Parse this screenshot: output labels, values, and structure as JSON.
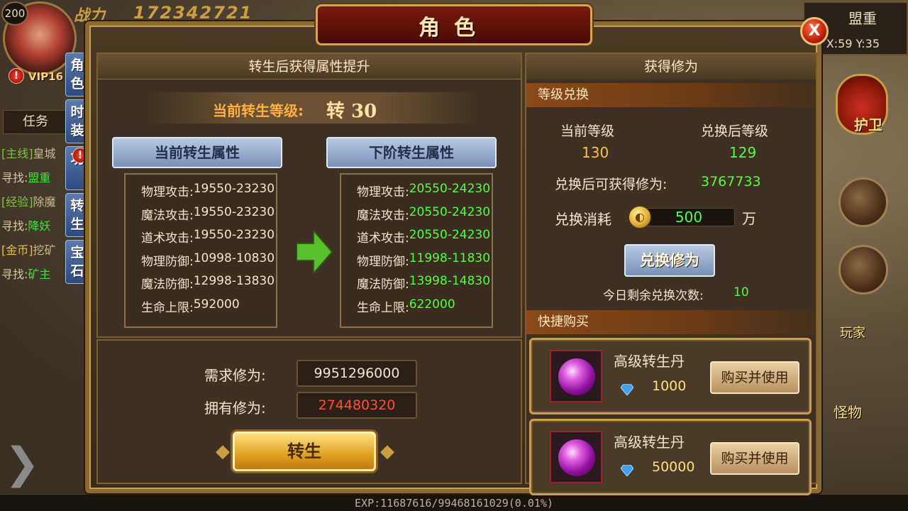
{
  "hud": {
    "player_level": "200",
    "vip": "VIP16",
    "combat_label": "战力",
    "combat_power": "172342721",
    "task_tab": "任务",
    "tasks": [
      {
        "tag": "[主线]",
        "text": "皇城"
      },
      {
        "find": "寻找:",
        "link": "盟重"
      },
      {
        "tag": "[经验]",
        "text": "除魔"
      },
      {
        "find": "寻找:",
        "link": "降妖"
      },
      {
        "tag": "[金币]",
        "text": "挖矿"
      },
      {
        "find": "寻找:",
        "link": "矿主"
      }
    ],
    "side_tabs": [
      "角色",
      "时装",
      "功",
      "转生",
      "宝石"
    ],
    "map_name": "盟重",
    "map_coords": "X:59 Y:35",
    "guard_label": "护卫",
    "player_label": "玩家",
    "monster_label": "怪物",
    "exp_text": "EXP:11687616/99468161029(0.01%)"
  },
  "panel": {
    "title": "角色",
    "close_label": "X"
  },
  "rebirth": {
    "header": "转生后获得属性提升",
    "current_level_label": "当前转生等级:",
    "current_level_value": "转 30",
    "current_attr_title": "当前转生属性",
    "next_attr_title": "下阶转生属性",
    "current_stats": [
      {
        "k": "物理攻击:",
        "v": "19550-23230"
      },
      {
        "k": "魔法攻击:",
        "v": "19550-23230"
      },
      {
        "k": "道术攻击:",
        "v": "19550-23230"
      },
      {
        "k": "物理防御:",
        "v": "10998-10830"
      },
      {
        "k": "魔法防御:",
        "v": "12998-13830"
      },
      {
        "k": "生命上限:",
        "v": "592000"
      }
    ],
    "next_stats": [
      {
        "k": "物理攻击:",
        "v": "20550-24230"
      },
      {
        "k": "魔法攻击:",
        "v": "20550-24230"
      },
      {
        "k": "道术攻击:",
        "v": "20550-24230"
      },
      {
        "k": "物理防御:",
        "v": "11998-11830"
      },
      {
        "k": "魔法防御:",
        "v": "13998-14830"
      },
      {
        "k": "生命上限:",
        "v": "622000"
      }
    ],
    "required_label": "需求修为:",
    "required_value": "9951296000",
    "owned_label": "拥有修为:",
    "owned_value": "274480320",
    "button_label": "转生"
  },
  "cultivation": {
    "header": "获得修为",
    "exchange_section": "等级兑换",
    "cur_level_label": "当前等级",
    "cur_level_value": "130",
    "after_level_label": "兑换后等级",
    "after_level_value": "129",
    "gain_label": "兑换后可获得修为:",
    "gain_value": "3767733",
    "cost_label": "兑换消耗",
    "cost_value": "500",
    "cost_unit": "万",
    "exchange_button": "兑换修为",
    "remain_label": "今日剩余兑换次数:",
    "remain_value": "10",
    "quickbuy_section": "快捷购买",
    "items": [
      {
        "name": "高级转生丹",
        "price": "1000",
        "button": "购买并使用"
      },
      {
        "name": "高级转生丹",
        "price": "50000",
        "button": "购买并使用"
      }
    ]
  },
  "colors": {
    "green_value": "#50ff40",
    "red_value": "#ff5030",
    "gold_accent": "#c8a050"
  }
}
